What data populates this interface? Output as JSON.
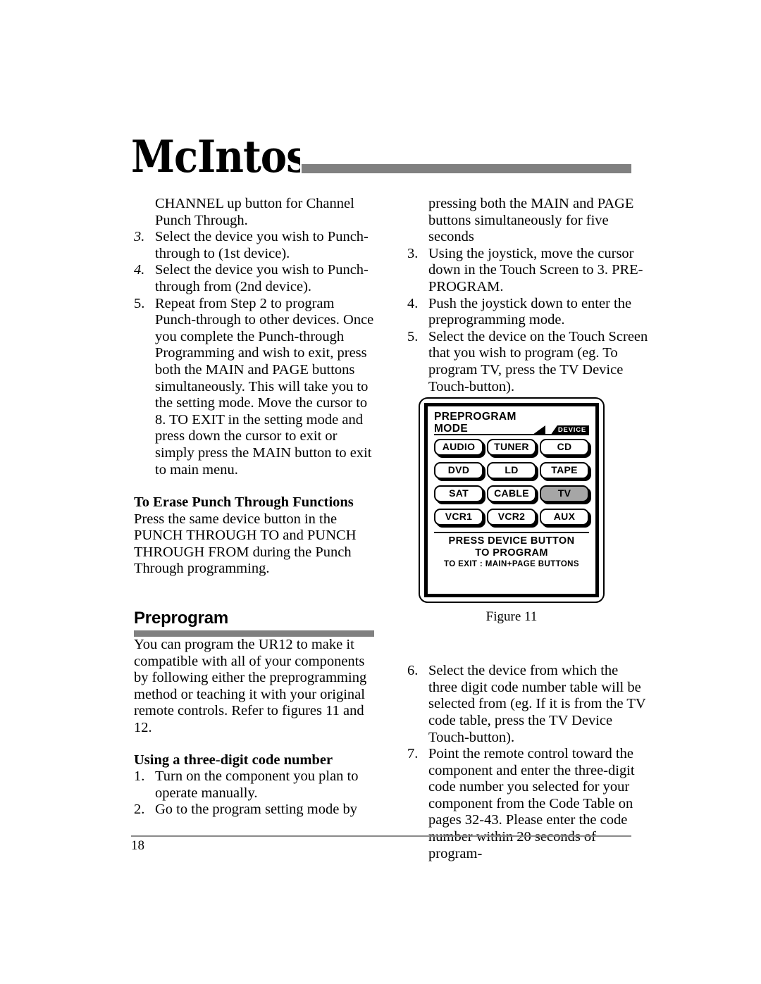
{
  "masthead": {
    "brand": "McIntosh"
  },
  "left_column": {
    "continued_paragraph": {
      "line1": "CHANNEL up button for Channel",
      "line2": "Punch Through."
    },
    "steps": [
      {
        "num": "3.",
        "italic_num": false,
        "text": "Select the device you wish to Punch-through to (1st device)."
      },
      {
        "num": "4.",
        "italic_num": true,
        "text": "Select the device you wish to Punch-through from (2nd device)."
      },
      {
        "num": "5.",
        "italic_num": false,
        "text": "Repeat from Step 2 to program Punch-through to other devices. Once you complete the Punch-through Programming and wish to exit, press both the MAIN and PAGE buttons simultaneously. This will take you to the setting mode. Move the cursor to 8. TO EXIT in the setting mode and press down the cursor to exit or simply press the MAIN button to exit to main menu."
      }
    ],
    "erase_heading": "To Erase Punch Through Functions",
    "erase_body": "Press the same device button in the PUNCH THROUGH TO and PUNCH THROUGH FROM during the Punch Through programming.",
    "section_heading": "Preprogram",
    "section_body": "You can program the UR12 to make it compatible with all of your components by following either the preprogramming method or teaching it with your original remote controls. Refer to figures 11 and 12.",
    "code_heading": "Using a three-digit code number",
    "code_steps": [
      {
        "num": "1.",
        "text": "Turn on the component you plan to operate manually."
      },
      {
        "num": "2.",
        "text": "Go to the program setting mode by"
      }
    ]
  },
  "right_column": {
    "continued_paragraph": "pressing both the MAIN and PAGE buttons simultaneously for five seconds",
    "steps_upper": [
      {
        "num": "3.",
        "text": "Using the joystick, move the cursor down in the Touch Screen to 3. PRE-PROGRAM."
      },
      {
        "num": "4.",
        "text": "Push the joystick down to enter the preprogramming mode."
      },
      {
        "num": "5.",
        "text": "Select the device on the Touch Screen that you wish to program (eg. To program TV, press the TV Device Touch-button)."
      }
    ],
    "steps_lower": [
      {
        "num": "6.",
        "text": "Select the device from which the three digit code number table will be selected from (eg. If it is from the TV code table, press the TV Device Touch-button)."
      },
      {
        "num": "7.",
        "text": "Point the remote control toward the component and enter the three-digit code number you selected for your component from the Code Table on pages 32-43. Please enter the code number within 20 seconds of program-"
      }
    ]
  },
  "figure": {
    "caption": "Figure 11",
    "screen": {
      "title_line1": "PREPROGRAM",
      "title_line2": "MODE",
      "device_tab": "DEVICE",
      "buttons": [
        [
          {
            "label": "AUDIO",
            "selected": false
          },
          {
            "label": "TUNER",
            "selected": false
          },
          {
            "label": "CD",
            "selected": false
          }
        ],
        [
          {
            "label": "DVD",
            "selected": false
          },
          {
            "label": "LD",
            "selected": false
          },
          {
            "label": "TAPE",
            "selected": false
          }
        ],
        [
          {
            "label": "SAT",
            "selected": false
          },
          {
            "label": "CABLE",
            "selected": false
          },
          {
            "label": "TV",
            "selected": true
          }
        ],
        [
          {
            "label": "VCR1",
            "selected": false
          },
          {
            "label": "VCR2",
            "selected": false
          },
          {
            "label": "AUX",
            "selected": false
          }
        ]
      ],
      "footer_line1": "PRESS  DEVICE  BUTTON",
      "footer_line2": "TO  PROGRAM",
      "footer_line3": "TO  EXIT :    MAIN+PAGE  BUTTONS"
    },
    "selected_color": "#a6a6a6"
  },
  "footer": {
    "page_number": "18"
  }
}
